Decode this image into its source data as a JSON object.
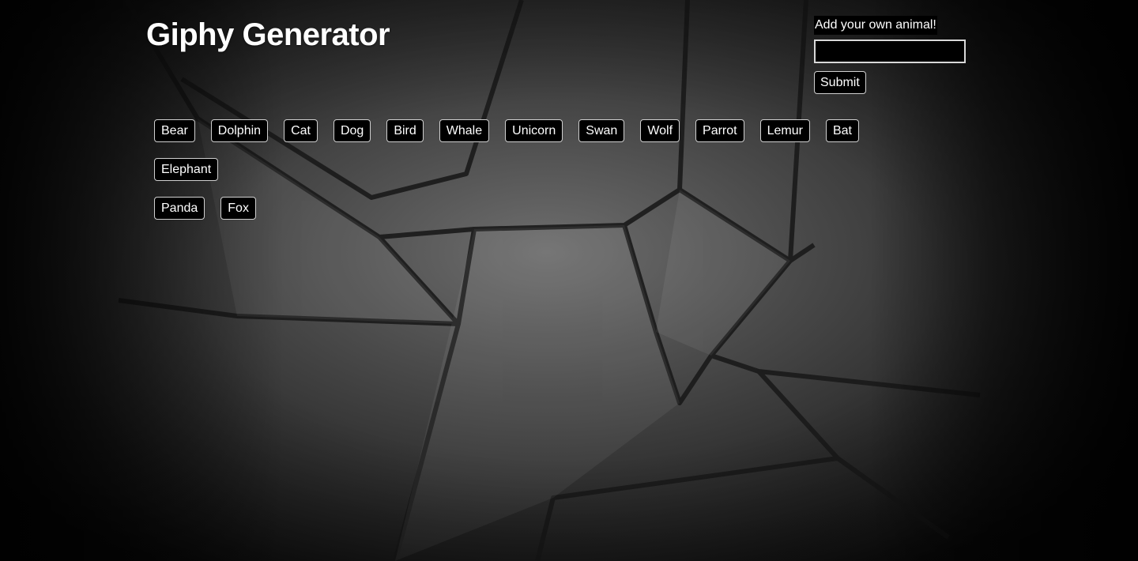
{
  "header": {
    "title": "Giphy Generator"
  },
  "add_form": {
    "label": "Add your own animal!",
    "input_value": "",
    "submit_label": "Submit"
  },
  "animals": [
    "Bear",
    "Dolphin",
    "Cat",
    "Dog",
    "Bird",
    "Whale",
    "Unicorn",
    "Swan",
    "Wolf",
    "Parrot",
    "Lemur",
    "Bat",
    "Elephant",
    "Panda",
    "Fox"
  ],
  "colors": {
    "button_background": "#000000",
    "button_text": "#ffffff",
    "button_border": "#d0d0d0"
  }
}
